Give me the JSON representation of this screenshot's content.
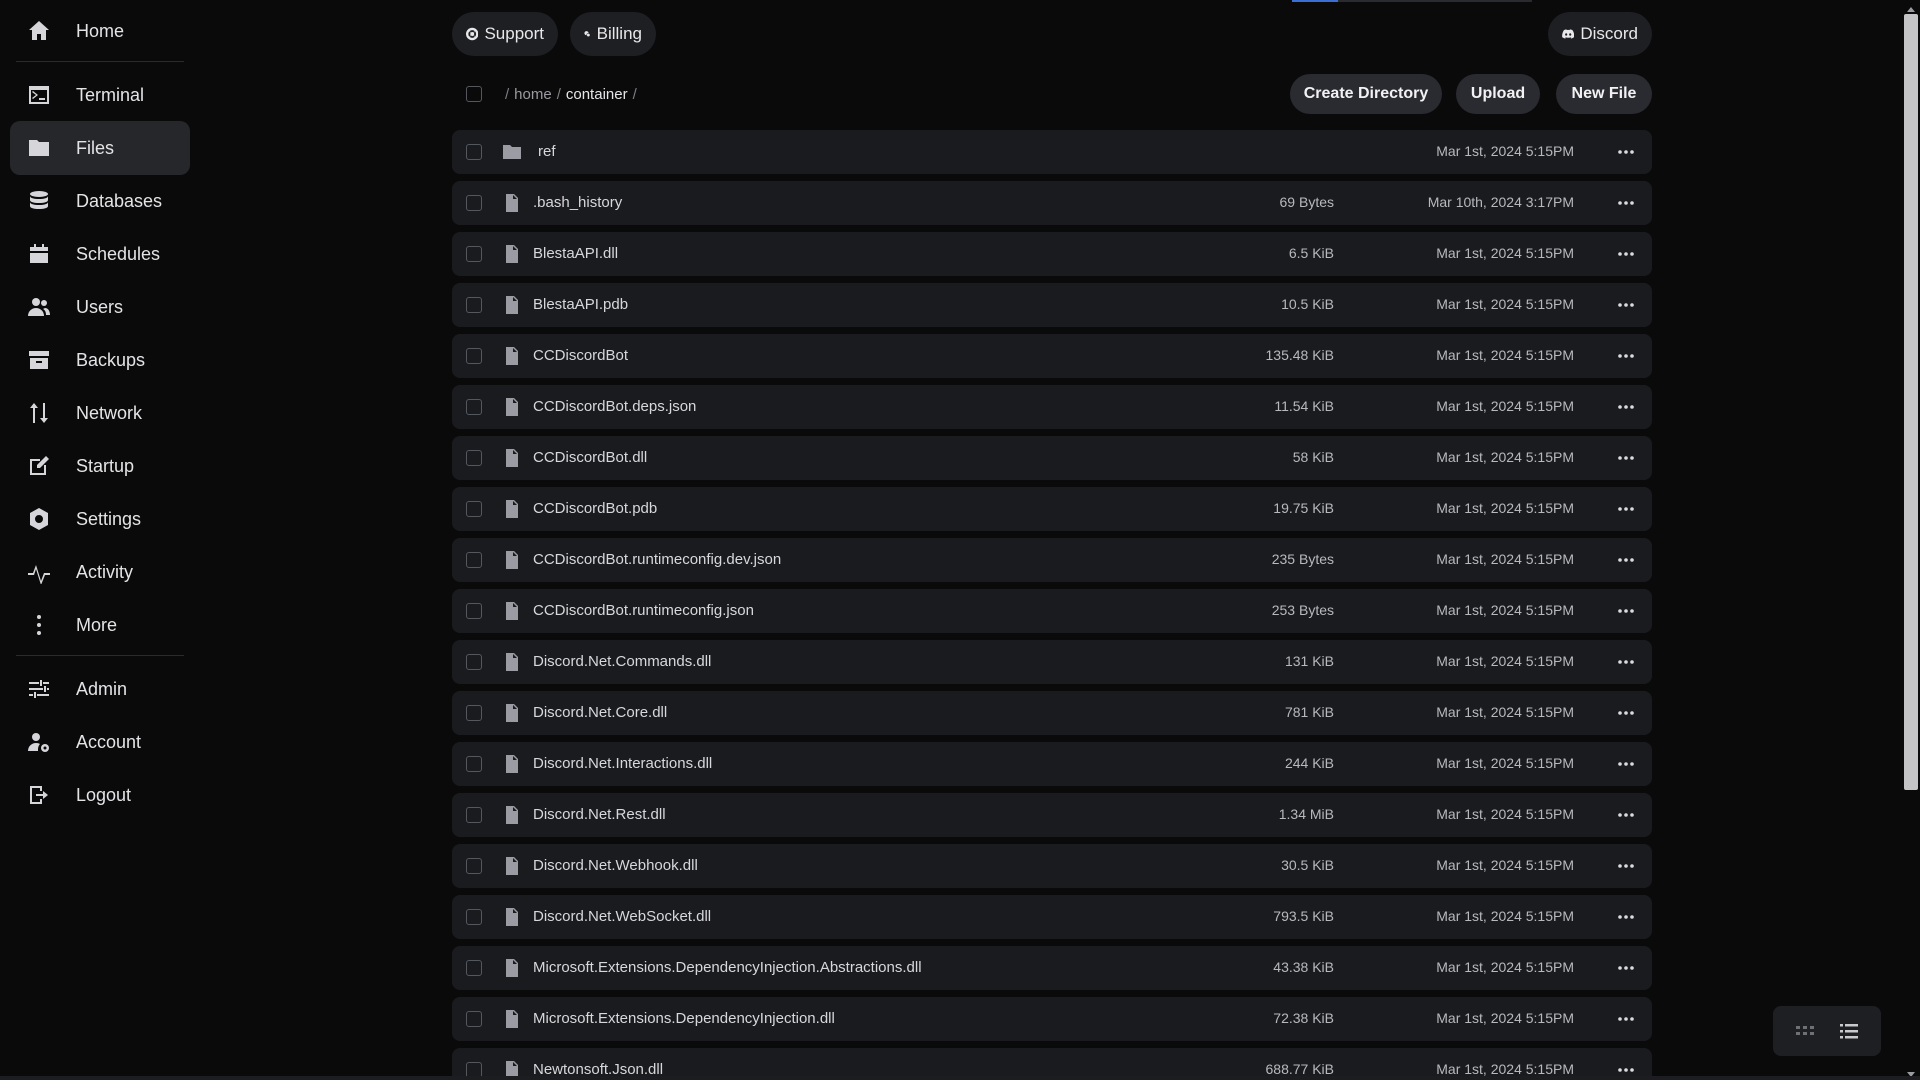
{
  "sidebar": {
    "items": [
      {
        "label": "Home",
        "icon": "home-icon"
      },
      {
        "label": "Terminal",
        "icon": "terminal-icon"
      },
      {
        "label": "Files",
        "icon": "folder-icon",
        "active": true
      },
      {
        "label": "Databases",
        "icon": "database-icon"
      },
      {
        "label": "Schedules",
        "icon": "calendar-icon"
      },
      {
        "label": "Users",
        "icon": "users-icon"
      },
      {
        "label": "Backups",
        "icon": "archive-icon"
      },
      {
        "label": "Network",
        "icon": "network-arrows-icon"
      },
      {
        "label": "Startup",
        "icon": "edit-icon"
      },
      {
        "label": "Settings",
        "icon": "settings-icon"
      },
      {
        "label": "Activity",
        "icon": "activity-icon"
      },
      {
        "label": "More",
        "icon": "more-vertical-icon"
      },
      {
        "label": "Admin",
        "icon": "sliders-icon"
      },
      {
        "label": "Account",
        "icon": "user-gear-icon"
      },
      {
        "label": "Logout",
        "icon": "logout-icon"
      }
    ]
  },
  "header": {
    "support_label": "Support",
    "billing_label": "Billing",
    "discord_label": "Discord"
  },
  "breadcrumb": {
    "root_sep": "/",
    "segments": [
      "home",
      "container"
    ],
    "trailing_sep": "/"
  },
  "actions": {
    "create_directory": "Create Directory",
    "upload": "Upload",
    "new_file": "New File"
  },
  "files": [
    {
      "name": "ref",
      "size": "",
      "date": "Mar 1st, 2024 5:15PM",
      "type": "folder"
    },
    {
      "name": ".bash_history",
      "size": "69 Bytes",
      "date": "Mar 10th, 2024 3:17PM",
      "type": "file"
    },
    {
      "name": "BlestaAPI.dll",
      "size": "6.5 KiB",
      "date": "Mar 1st, 2024 5:15PM",
      "type": "file"
    },
    {
      "name": "BlestaAPI.pdb",
      "size": "10.5 KiB",
      "date": "Mar 1st, 2024 5:15PM",
      "type": "file"
    },
    {
      "name": "CCDiscordBot",
      "size": "135.48 KiB",
      "date": "Mar 1st, 2024 5:15PM",
      "type": "file"
    },
    {
      "name": "CCDiscordBot.deps.json",
      "size": "11.54 KiB",
      "date": "Mar 1st, 2024 5:15PM",
      "type": "file"
    },
    {
      "name": "CCDiscordBot.dll",
      "size": "58 KiB",
      "date": "Mar 1st, 2024 5:15PM",
      "type": "file"
    },
    {
      "name": "CCDiscordBot.pdb",
      "size": "19.75 KiB",
      "date": "Mar 1st, 2024 5:15PM",
      "type": "file"
    },
    {
      "name": "CCDiscordBot.runtimeconfig.dev.json",
      "size": "235 Bytes",
      "date": "Mar 1st, 2024 5:15PM",
      "type": "file"
    },
    {
      "name": "CCDiscordBot.runtimeconfig.json",
      "size": "253 Bytes",
      "date": "Mar 1st, 2024 5:15PM",
      "type": "file"
    },
    {
      "name": "Discord.Net.Commands.dll",
      "size": "131 KiB",
      "date": "Mar 1st, 2024 5:15PM",
      "type": "file"
    },
    {
      "name": "Discord.Net.Core.dll",
      "size": "781 KiB",
      "date": "Mar 1st, 2024 5:15PM",
      "type": "file"
    },
    {
      "name": "Discord.Net.Interactions.dll",
      "size": "244 KiB",
      "date": "Mar 1st, 2024 5:15PM",
      "type": "file"
    },
    {
      "name": "Discord.Net.Rest.dll",
      "size": "1.34 MiB",
      "date": "Mar 1st, 2024 5:15PM",
      "type": "file"
    },
    {
      "name": "Discord.Net.Webhook.dll",
      "size": "30.5 KiB",
      "date": "Mar 1st, 2024 5:15PM",
      "type": "file"
    },
    {
      "name": "Discord.Net.WebSocket.dll",
      "size": "793.5 KiB",
      "date": "Mar 1st, 2024 5:15PM",
      "type": "file"
    },
    {
      "name": "Microsoft.Extensions.DependencyInjection.Abstractions.dll",
      "size": "43.38 KiB",
      "date": "Mar 1st, 2024 5:15PM",
      "type": "file"
    },
    {
      "name": "Microsoft.Extensions.DependencyInjection.dll",
      "size": "72.38 KiB",
      "date": "Mar 1st, 2024 5:15PM",
      "type": "file"
    },
    {
      "name": "Newtonsoft.Json.dll",
      "size": "688.77 KiB",
      "date": "Mar 1st, 2024 5:15PM",
      "type": "file"
    }
  ],
  "view_toggle": {
    "active": "list-view-icon",
    "options": [
      "grid-view-icon",
      "list-view-icon"
    ]
  },
  "colors": {
    "background": "#0a0a0b",
    "row": "#1a1b1e",
    "active_nav": "#26272b",
    "button": "#2a2b30",
    "accent": "#3b6fd4"
  }
}
